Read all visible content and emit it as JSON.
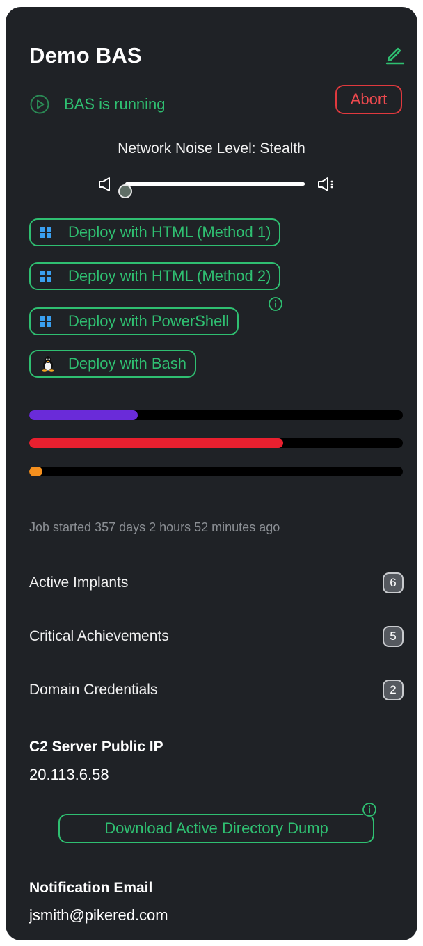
{
  "header": {
    "title": "Demo BAS",
    "edit_icon": "pencil-icon"
  },
  "status": {
    "text": "BAS is running",
    "icon": "play-circle-icon",
    "abort_label": "Abort",
    "color": "#2fbf71",
    "abort_color": "#e0393e"
  },
  "noise": {
    "label": "Network Noise Level: Stealth",
    "level": 0.0,
    "icon_low": "volume-low-icon",
    "icon_high": "volume-high-icon"
  },
  "deploy": {
    "buttons": [
      {
        "label": "Deploy with HTML (Method 1)",
        "icon": "windows-icon"
      },
      {
        "label": "Deploy with HTML (Method 2)",
        "icon": "windows-icon"
      },
      {
        "label": "Deploy with PowerShell",
        "icon": "windows-icon",
        "info": "info-icon"
      },
      {
        "label": "Deploy with Bash",
        "icon": "linux-tux-icon"
      }
    ]
  },
  "progress": {
    "bars": [
      {
        "fraction": 0.29,
        "color": "#6a2bd9"
      },
      {
        "fraction": 0.68,
        "color": "#e8202f"
      },
      {
        "fraction": 0.035,
        "color": "#f5901e"
      }
    ]
  },
  "job": {
    "started": "Job started 357 days 2 hours 52 minutes ago"
  },
  "stats": [
    {
      "label": "Active Implants",
      "count": "6"
    },
    {
      "label": "Critical Achievements",
      "count": "5"
    },
    {
      "label": "Domain Credentials",
      "count": "2"
    }
  ],
  "c2": {
    "heading": "C2 Server Public IP",
    "value": "20.113.6.58"
  },
  "download": {
    "label": "Download Active Directory Dump",
    "info": "info-icon"
  },
  "notification": {
    "heading": "Notification Email",
    "value": "jsmith@pikered.com"
  }
}
